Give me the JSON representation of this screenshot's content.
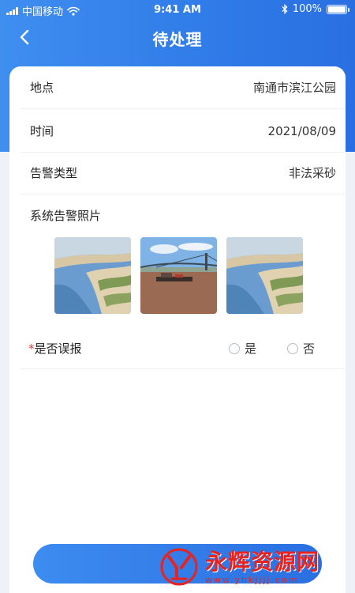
{
  "status_bar": {
    "carrier": "中国移动",
    "time": "9:41 AM",
    "battery": "100%",
    "battery_level": 1.0
  },
  "nav": {
    "title": "待处理"
  },
  "details": [
    {
      "label": "地点",
      "value": "南通市滨江公园"
    },
    {
      "label": "时间",
      "value": "2021/08/09"
    },
    {
      "label": "告警类型",
      "value": "非法采砂"
    }
  ],
  "photos": {
    "title": "系统告警照片",
    "items": [
      "riverbank-aerial",
      "bridge-river-boat",
      "riverbank-aerial"
    ]
  },
  "false_alarm": {
    "required_mark": "*",
    "label": "是否误报",
    "options": [
      "是",
      "否"
    ]
  },
  "watermark": {
    "text": "永辉资源网",
    "url": "www.yhkjjjj.com"
  },
  "colors": {
    "primary": "#2f7be8",
    "required": "#e53935",
    "watermark": "#e8231f"
  }
}
